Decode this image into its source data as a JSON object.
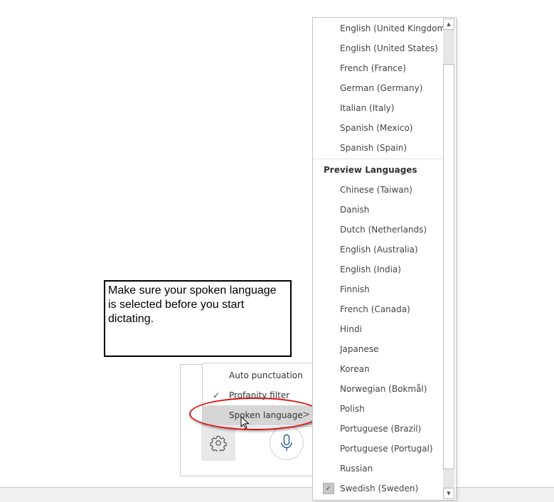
{
  "callout": {
    "text": "Make sure your spoken language is selected before you start dictating."
  },
  "settings_menu": {
    "items": [
      {
        "label": "Auto punctuation",
        "checked": false,
        "submenu": false
      },
      {
        "label": "Profanity filter",
        "checked": true,
        "submenu": false
      },
      {
        "label": "Spoken language",
        "checked": false,
        "submenu": true,
        "highlighted": true
      }
    ],
    "check_glyph": "✓",
    "chevron_glyph": ">"
  },
  "toolbar": {
    "settings_icon": "gear-icon",
    "mic_icon": "microphone-icon",
    "mic_color": "#2b5797"
  },
  "language_dropdown": {
    "languages": [
      "English (United Kingdom)",
      "English (United States)",
      "French (France)",
      "German (Germany)",
      "Italian (Italy)",
      "Spanish (Mexico)",
      "Spanish (Spain)"
    ],
    "preview_header": "Preview Languages",
    "preview_languages": [
      "Chinese (Taiwan)",
      "Danish",
      "Dutch (Netherlands)",
      "English (Australia)",
      "English (India)",
      "Finnish",
      "French (Canada)",
      "Hindi",
      "Japanese",
      "Korean",
      "Norwegian (Bokmål)",
      "Polish",
      "Portuguese (Brazil)",
      "Portuguese (Portugal)",
      "Russian",
      "Swedish (Sweden)"
    ],
    "selected": "Swedish (Sweden)",
    "check_glyph": "✓",
    "scroll_up_glyph": "▲",
    "scroll_down_glyph": "▼"
  },
  "annotation": {
    "highlight_color": "#e01010"
  }
}
